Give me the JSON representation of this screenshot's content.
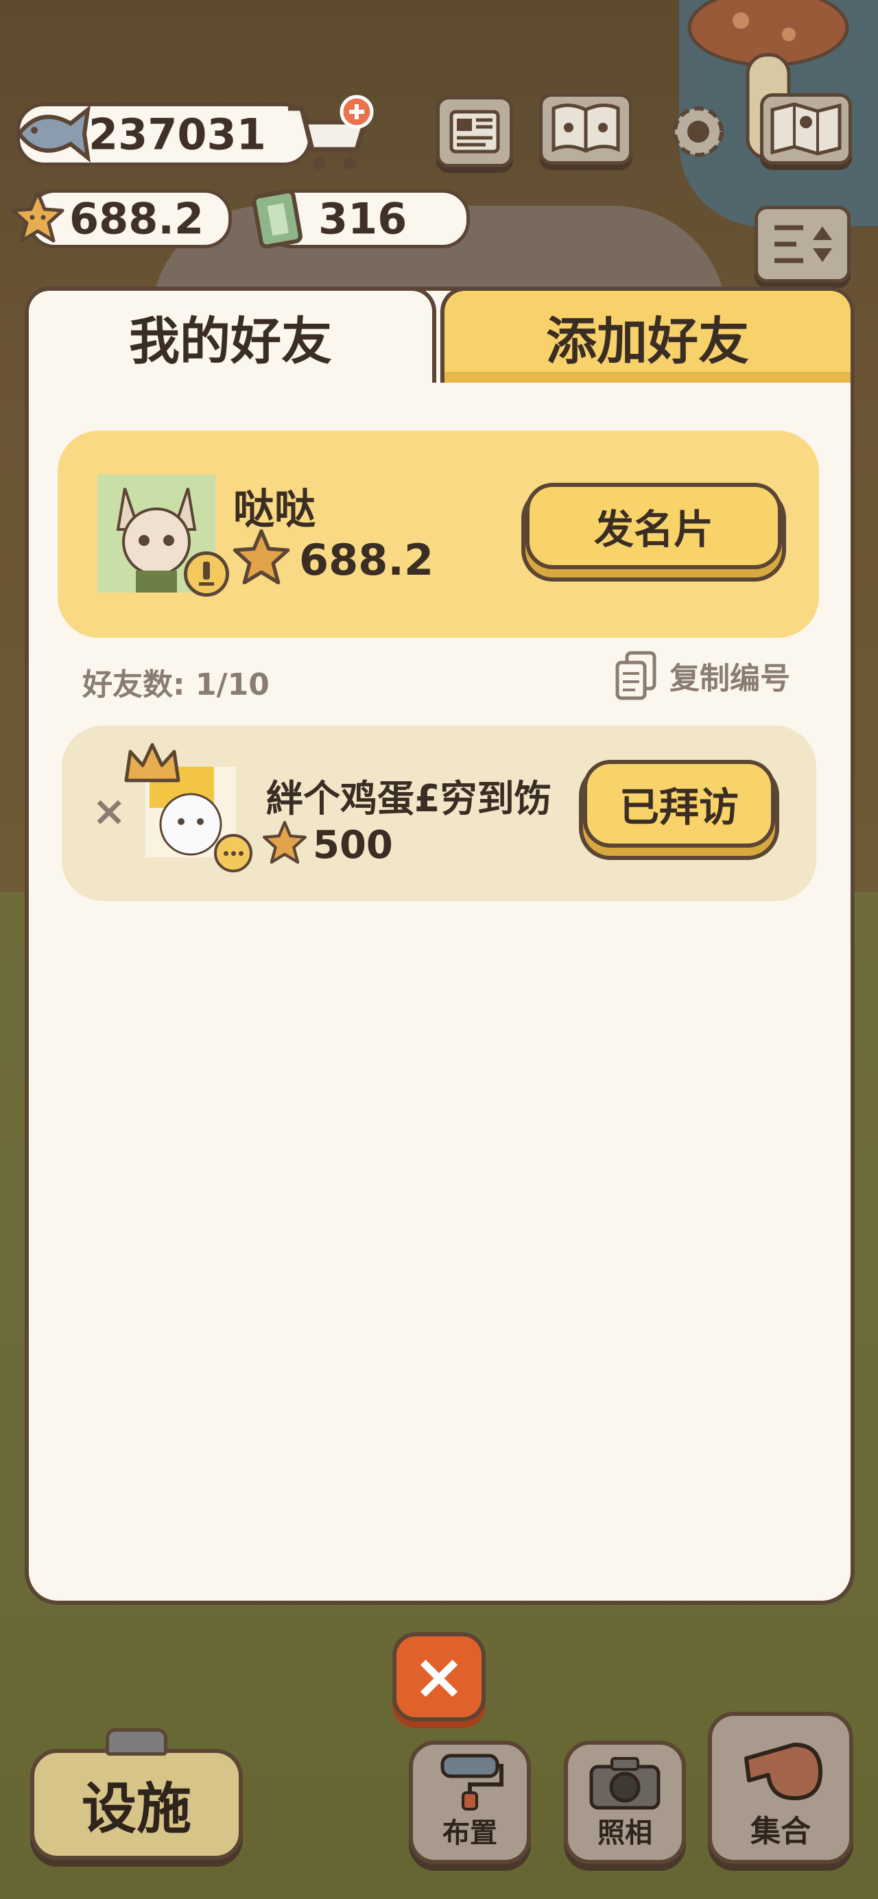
{
  "hud": {
    "fish_count": "237031",
    "star_count": "688.2",
    "ticket_count": "316",
    "icons": [
      "fish-icon",
      "cart-add-icon",
      "star-icon",
      "ticket-icon",
      "newspaper-icon",
      "pawbook-icon",
      "gear-icon",
      "map-icon",
      "sort-toggle-icon"
    ]
  },
  "tabs": {
    "my_friends": "我的好友",
    "add_friend": "添加好友"
  },
  "self_card": {
    "name": "哒哒",
    "stars": "688.2",
    "button": "发名片"
  },
  "friend_count_label": "好友数: 1/10",
  "copy_id_label": "复制编号",
  "friends": [
    {
      "remove_symbol": "×",
      "name": "絆个鸡蛋£穷到饬",
      "stars": "500",
      "button": "已拜访"
    }
  ],
  "close_symbol": "×",
  "bottom_bar": {
    "facility": "设施",
    "arrange": "布置",
    "photo": "照相",
    "gather": "集合"
  },
  "colors": {
    "accent_yellow": "#f8d36a",
    "outline_brown": "#5b4535",
    "panel_cream": "#fcf7ee",
    "close_orange": "#e0622a"
  }
}
